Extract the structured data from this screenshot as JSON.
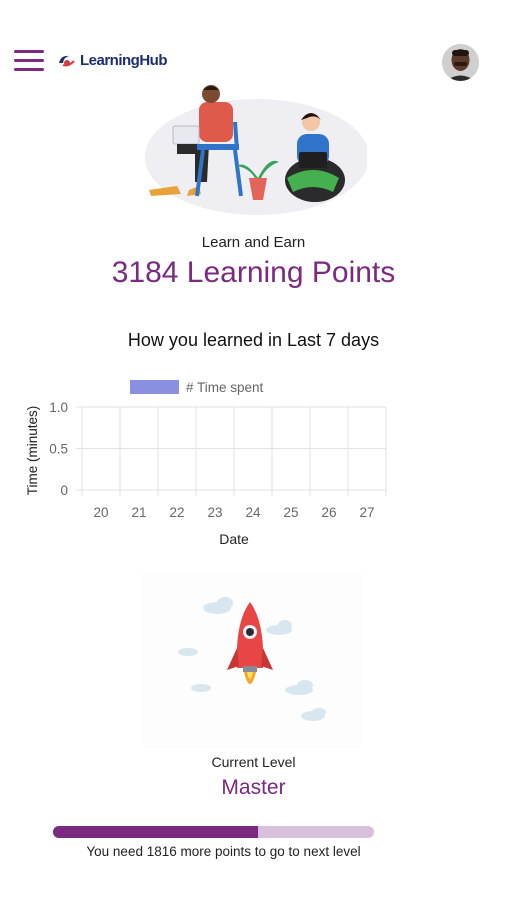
{
  "header": {
    "logo_text": "LearningHub"
  },
  "summary": {
    "earn_label": "Learn and Earn",
    "points_text": "3184 Learning Points"
  },
  "chart": {
    "title": "How you learned in Last 7 days"
  },
  "chart_data": {
    "type": "bar",
    "categories": [
      "20",
      "21",
      "22",
      "23",
      "24",
      "25",
      "26",
      "27"
    ],
    "series": [
      {
        "name": "# Time spent",
        "values": [
          0,
          0,
          0,
          0,
          0,
          0,
          0,
          0
        ],
        "color": "#8a8fe0"
      }
    ],
    "xlabel": "Date",
    "ylabel": "Time (minutes)",
    "ylim": [
      0,
      1.0
    ],
    "yticks": [
      "0",
      "0.5",
      "1.0"
    ],
    "grid": true,
    "legend": "top"
  },
  "level": {
    "label": "Current Level",
    "name": "Master",
    "progress_fraction": 0.64,
    "progress_text": "You need 1816 more points to go to next level"
  },
  "colors": {
    "brand": "#7a2a80",
    "progress_track": "#d8bfdc"
  },
  "icons": {
    "menu": "hamburger-menu-icon",
    "avatar": "user-avatar",
    "rocket": "rocket-illustration"
  }
}
